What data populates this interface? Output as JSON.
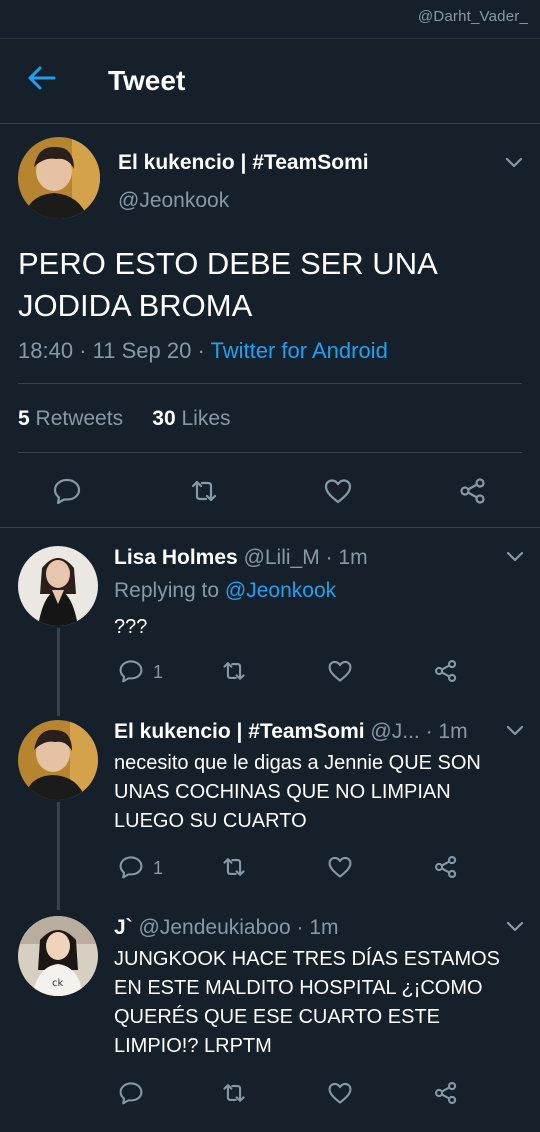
{
  "watermark": "@Darht_Vader_",
  "header": {
    "title": "Tweet"
  },
  "tweet": {
    "name": "El kukencio | #TeamSomi",
    "handle": "@Jeonkook",
    "text": "PERO ESTO DEBE SER UNA JODIDA BROMA",
    "time": "18:40",
    "date": "11 Sep 20",
    "source": "Twitter for Android",
    "retweets": "5",
    "retweets_label": "Retweets",
    "likes": "30",
    "likes_label": "Likes"
  },
  "replies": [
    {
      "name": "Lisa Holmes",
      "handle": "@Lili_M",
      "time": "1m",
      "replying_label": "Replying to",
      "replying_to": "@Jeonkook",
      "text": "???",
      "reply_count": "1"
    },
    {
      "name": "El kukencio | #TeamSomi",
      "handle": "@J...",
      "time": "1m",
      "text": "necesito que le digas a Jennie QUE SON UNAS COCHINAS QUE NO LIMPIAN LUEGO SU CUARTO",
      "reply_count": "1"
    },
    {
      "name": "J`",
      "handle": "@Jendeukiaboo",
      "time": "1m",
      "text": "JUNGKOOK HACE TRES DÍAS ESTAMOS EN ESTE MALDITO HOSPITAL ¿¡COMO QUERÉS QUE ESE CUARTO ESTE LIMPIO!? LRPTM",
      "reply_count": ""
    }
  ],
  "colors": {
    "background": "#15202b",
    "accent": "#1da1f2",
    "secondary_text": "#8899a6",
    "divider": "#38444d"
  },
  "icons": [
    "back-arrow-icon",
    "chevron-down-icon",
    "reply-icon",
    "retweet-icon",
    "like-icon",
    "share-icon"
  ]
}
